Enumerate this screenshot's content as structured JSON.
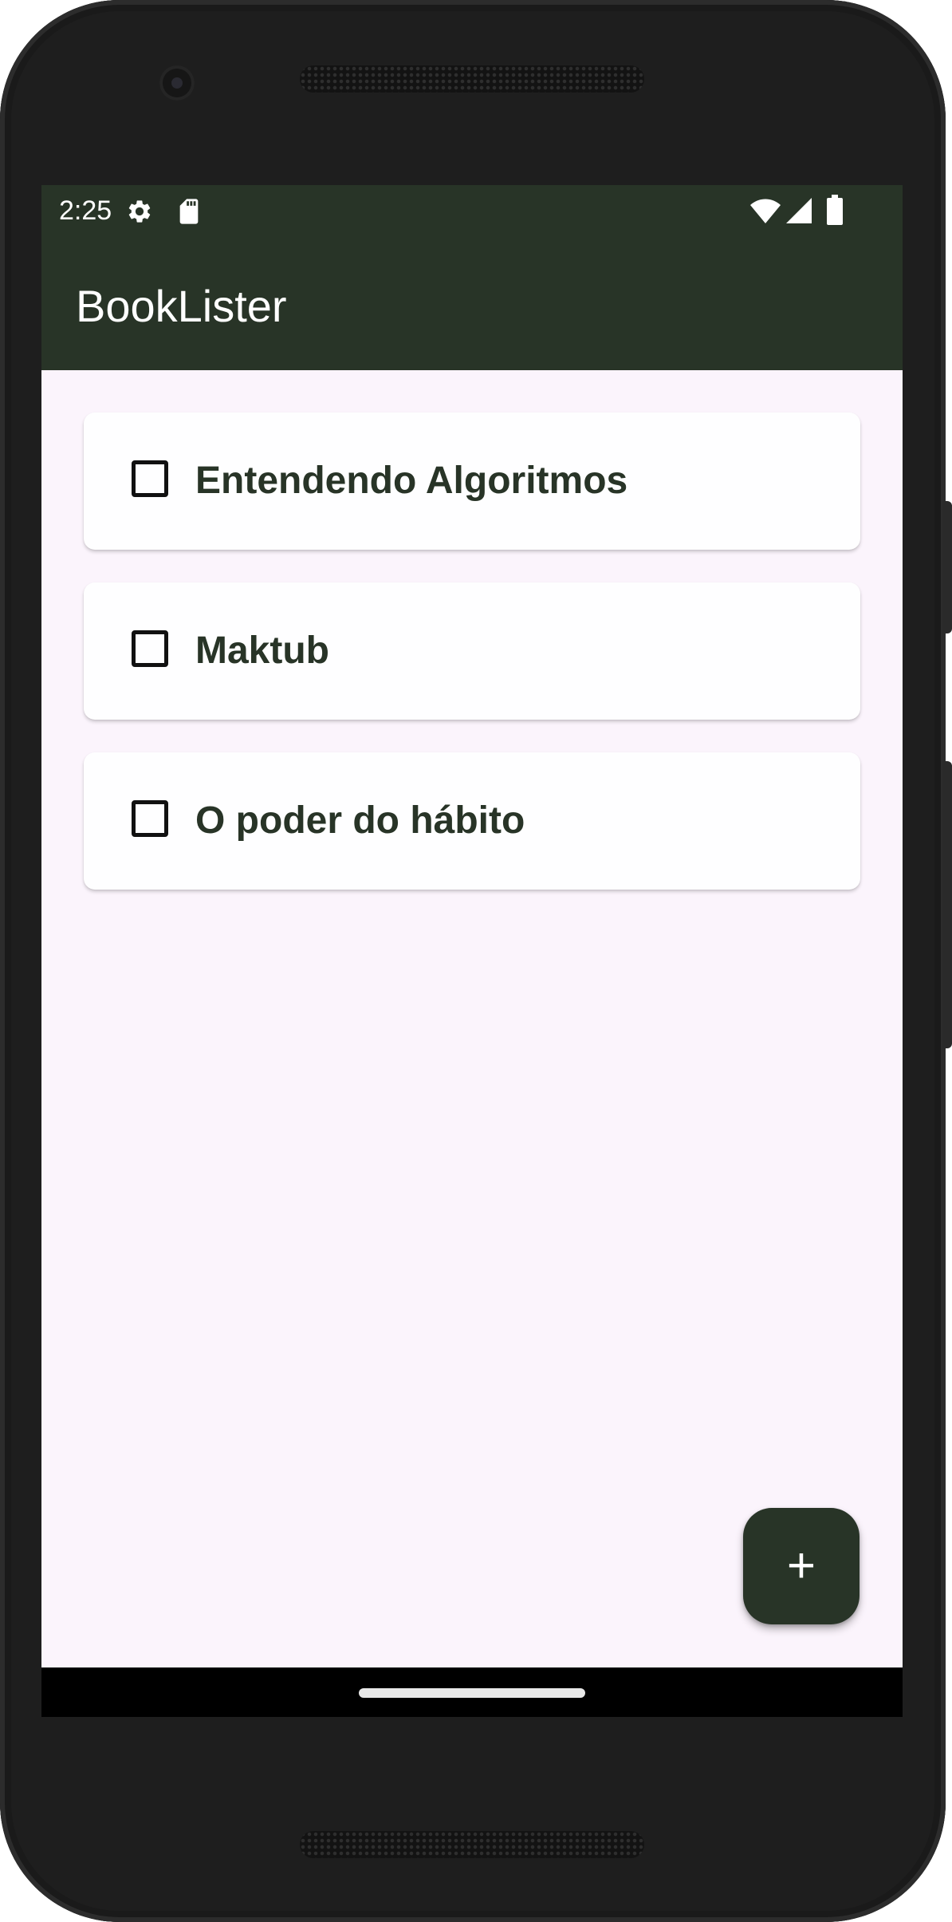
{
  "status_bar": {
    "time": "2:25",
    "left_icons": [
      "gear-icon",
      "sd-card-icon"
    ],
    "right_icons": [
      "wifi-icon",
      "cell-signal-icon",
      "battery-icon"
    ]
  },
  "app_bar": {
    "title": "BookLister"
  },
  "books": [
    {
      "title": "Entendendo Algoritmos",
      "checked": false
    },
    {
      "title": "Maktub",
      "checked": false
    },
    {
      "title": "O poder do hábito",
      "checked": false
    }
  ],
  "fab": {
    "label": "+",
    "icon": "plus-icon"
  },
  "colors": {
    "primary": "#283427",
    "background": "#fbf4fc",
    "card": "#fefeff",
    "on_primary": "#ffffff"
  }
}
